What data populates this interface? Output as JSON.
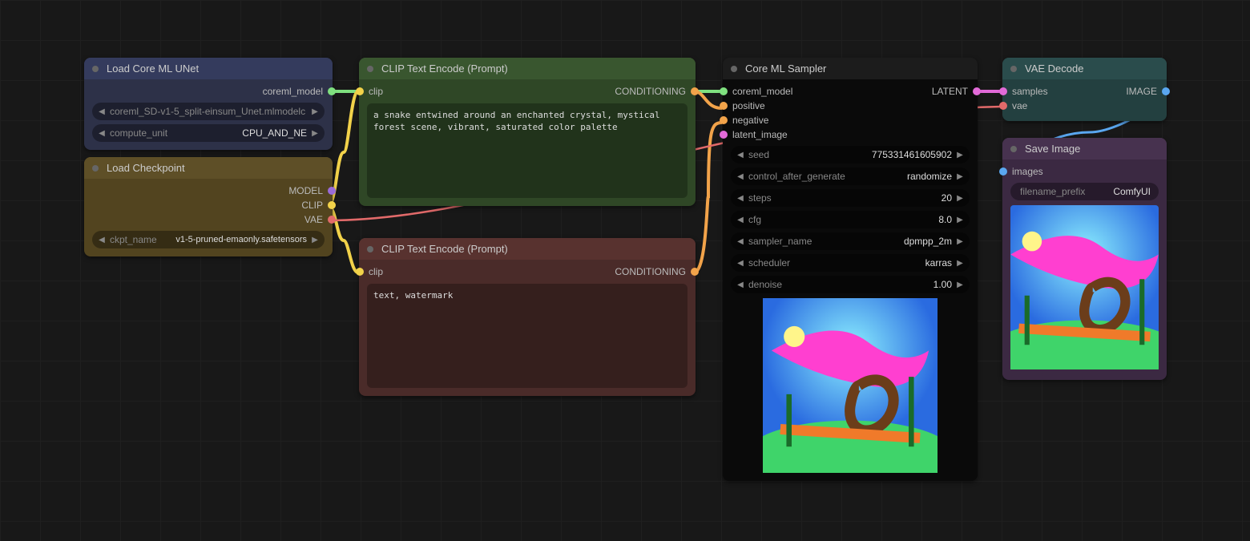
{
  "colors": {
    "model": "#7fe07f",
    "clip": "#f2d24a",
    "vae": "#e26a6a",
    "cond": "#f2a34a",
    "latent": "#e26ad8",
    "image": "#5aa7f0"
  },
  "nodes": {
    "unet": {
      "title": "Load Core ML UNet",
      "outputs": {
        "coreml_model": "coreml_model"
      },
      "widgets": {
        "model": {
          "label": "coreml_SD-v1-5_split-einsum_Unet.mlmodelc",
          "value": "SD-v1-5_split-einsum_Unet.mlmodelc"
        },
        "compute_unit": {
          "label": "compute_unit",
          "value": "CPU_AND_NE"
        }
      }
    },
    "ckpt": {
      "title": "Load Checkpoint",
      "outputs": {
        "model": "MODEL",
        "clip": "CLIP",
        "vae": "VAE"
      },
      "widgets": {
        "ckpt": {
          "label": "ckpt_name",
          "value": "v1-5-pruned-emaonly.safetensors"
        }
      }
    },
    "pos": {
      "title": "CLIP Text Encode (Prompt)",
      "inputs": {
        "clip": "clip"
      },
      "outputs": {
        "cond": "CONDITIONING"
      },
      "prompt": "a snake entwined around an enchanted crystal, mystical forest scene, vibrant, saturated color palette"
    },
    "neg": {
      "title": "CLIP Text Encode (Prompt)",
      "inputs": {
        "clip": "clip"
      },
      "outputs": {
        "cond": "CONDITIONING"
      },
      "prompt": "text, watermark"
    },
    "sampler": {
      "title": "Core ML Sampler",
      "inputs": {
        "coreml_model": "coreml_model",
        "positive": "positive",
        "negative": "negative",
        "latent_image": "latent_image"
      },
      "outputs": {
        "latent": "LATENT"
      },
      "widgets": {
        "seed": {
          "label": "seed",
          "value": "775331461605902"
        },
        "control": {
          "label": "control_after_generate",
          "value": "randomize"
        },
        "steps": {
          "label": "steps",
          "value": "20"
        },
        "cfg": {
          "label": "cfg",
          "value": "8.0"
        },
        "sampler": {
          "label": "sampler_name",
          "value": "dpmpp_2m"
        },
        "scheduler": {
          "label": "scheduler",
          "value": "karras"
        },
        "denoise": {
          "label": "denoise",
          "value": "1.00"
        }
      }
    },
    "vaedec": {
      "title": "VAE Decode",
      "inputs": {
        "samples": "samples",
        "vae": "vae"
      },
      "outputs": {
        "image": "IMAGE"
      }
    },
    "save": {
      "title": "Save Image",
      "inputs": {
        "images": "images"
      },
      "widgets": {
        "prefix": {
          "label": "filename_prefix",
          "value": "ComfyUI"
        }
      }
    }
  }
}
